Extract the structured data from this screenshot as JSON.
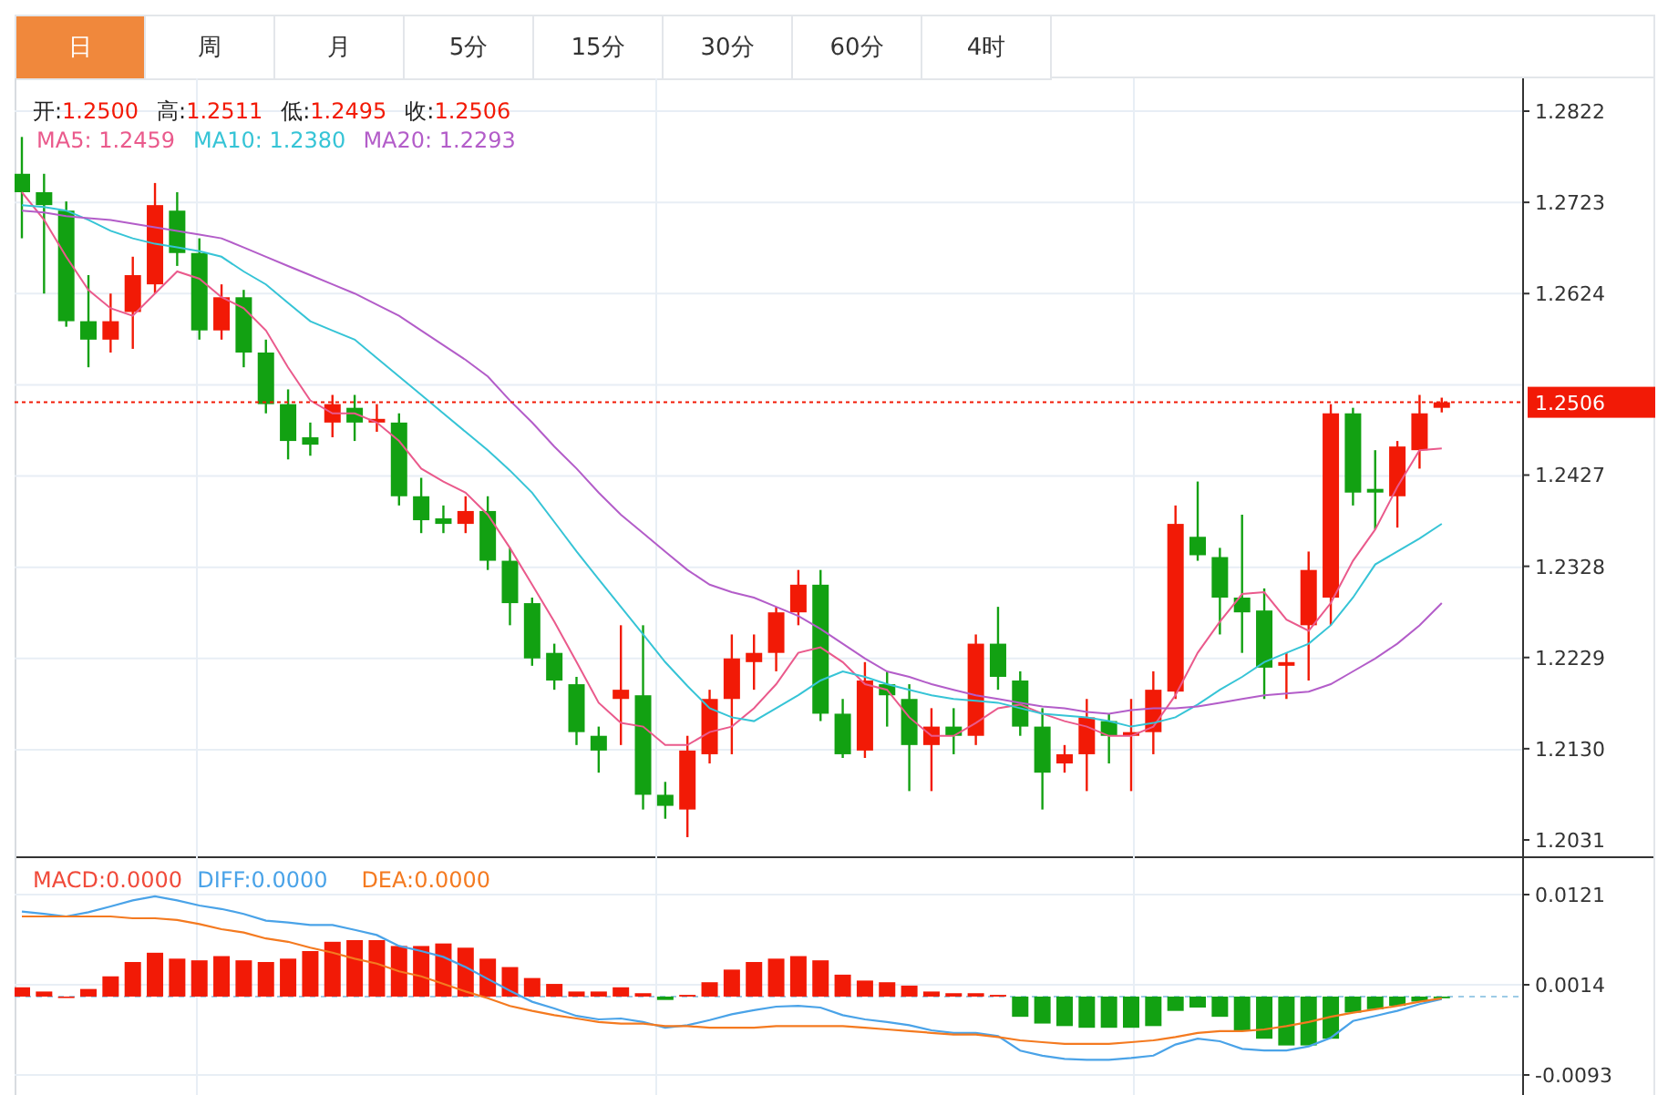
{
  "tabs": [
    {
      "label": "日",
      "selected": true
    },
    {
      "label": "周",
      "selected": false
    },
    {
      "label": "月",
      "selected": false
    },
    {
      "label": "5分",
      "selected": false
    },
    {
      "label": "15分",
      "selected": false
    },
    {
      "label": "30分",
      "selected": false
    },
    {
      "label": "60分",
      "selected": false
    },
    {
      "label": "4时",
      "selected": false
    }
  ],
  "price_chart": {
    "ohlc_legend": [
      {
        "label": "开:",
        "value": "1.2500"
      },
      {
        "label": "高:",
        "value": "1.2511"
      },
      {
        "label": "低:",
        "value": "1.2495"
      },
      {
        "label": "收:",
        "value": "1.2506"
      }
    ],
    "ma_legend": [
      {
        "label": "MA5:",
        "value": "1.2459",
        "color": "#ea5a8c"
      },
      {
        "label": "MA10:",
        "value": "1.2380",
        "color": "#36c4d6"
      },
      {
        "label": "MA20:",
        "value": "1.2293",
        "color": "#b35dc9"
      }
    ],
    "chart_data": {
      "type": "candlestick",
      "ylim": [
        1.2031,
        1.2822
      ],
      "grid": true,
      "ref_lines": [
        {
          "axis": "y",
          "value": 1.2506,
          "label": "1.2506",
          "color": "#f21a06"
        }
      ],
      "yticks": [
        {
          "value": 1.2822,
          "label": "1.2822"
        },
        {
          "value": 1.2723,
          "label": "1.2723"
        },
        {
          "value": 1.2624,
          "label": "1.2624"
        },
        {
          "value": 1.2427,
          "label": "1.2427"
        },
        {
          "value": 1.2328,
          "label": "1.2328"
        },
        {
          "value": 1.2229,
          "label": "1.2229"
        },
        {
          "value": 1.213,
          "label": "1.2130"
        },
        {
          "value": 1.2031,
          "label": "1.2031"
        }
      ],
      "ohlc": [
        [
          1.2754,
          1.2794,
          1.2684,
          1.2734
        ],
        [
          1.2734,
          1.2754,
          1.2624,
          1.272
        ],
        [
          1.2714,
          1.2724,
          1.2588,
          1.2594
        ],
        [
          1.2594,
          1.2644,
          1.2544,
          1.2574
        ],
        [
          1.2574,
          1.2624,
          1.256,
          1.2594
        ],
        [
          1.2604,
          1.2664,
          1.2564,
          1.2644
        ],
        [
          1.2634,
          1.2744,
          1.2624,
          1.272
        ],
        [
          1.2714,
          1.2734,
          1.2654,
          1.2668
        ],
        [
          1.2668,
          1.2684,
          1.2574,
          1.2584
        ],
        [
          1.2584,
          1.2634,
          1.2574,
          1.262
        ],
        [
          1.262,
          1.2628,
          1.2544,
          1.256
        ],
        [
          1.256,
          1.2574,
          1.2494,
          1.2504
        ],
        [
          1.2504,
          1.252,
          1.2444,
          1.2464
        ],
        [
          1.2468,
          1.2484,
          1.2448,
          1.246
        ],
        [
          1.2484,
          1.2514,
          1.2468,
          1.2504
        ],
        [
          1.25,
          1.2514,
          1.2464,
          1.2484
        ],
        [
          1.2484,
          1.2504,
          1.2474,
          1.2488
        ],
        [
          1.2484,
          1.2494,
          1.2394,
          1.2404
        ],
        [
          1.2404,
          1.2424,
          1.2364,
          1.2378
        ],
        [
          1.238,
          1.2394,
          1.2364,
          1.2374
        ],
        [
          1.2374,
          1.2404,
          1.2364,
          1.2388
        ],
        [
          1.2388,
          1.2404,
          1.2324,
          1.2334
        ],
        [
          1.2334,
          1.2348,
          1.2264,
          1.2288
        ],
        [
          1.2288,
          1.2294,
          1.222,
          1.2228
        ],
        [
          1.2234,
          1.2244,
          1.2194,
          1.2204
        ],
        [
          1.22,
          1.2208,
          1.2134,
          1.2148
        ],
        [
          1.2144,
          1.2154,
          1.2104,
          1.2128
        ],
        [
          1.2184,
          1.2264,
          1.2134,
          1.2194
        ],
        [
          1.2188,
          1.2264,
          1.2064,
          1.208
        ],
        [
          1.208,
          1.2094,
          1.2054,
          1.2068
        ],
        [
          1.2064,
          1.2144,
          1.2034,
          1.2128
        ],
        [
          1.2124,
          1.2194,
          1.2114,
          1.2184
        ],
        [
          1.2184,
          1.2254,
          1.2124,
          1.2228
        ],
        [
          1.2224,
          1.2254,
          1.2194,
          1.2234
        ],
        [
          1.2234,
          1.2284,
          1.2214,
          1.2278
        ],
        [
          1.2278,
          1.2324,
          1.2264,
          1.2308
        ],
        [
          1.2308,
          1.2324,
          1.216,
          1.2168
        ],
        [
          1.2168,
          1.2184,
          1.212,
          1.2124
        ],
        [
          1.2128,
          1.2224,
          1.212,
          1.2204
        ],
        [
          1.22,
          1.2214,
          1.2154,
          1.2188
        ],
        [
          1.2184,
          1.22,
          1.2084,
          1.2134
        ],
        [
          1.2134,
          1.2174,
          1.2084,
          1.2154
        ],
        [
          1.2154,
          1.2174,
          1.2124,
          1.2144
        ],
        [
          1.2144,
          1.2254,
          1.2134,
          1.2244
        ],
        [
          1.2244,
          1.2284,
          1.2194,
          1.2208
        ],
        [
          1.2204,
          1.2214,
          1.2144,
          1.2154
        ],
        [
          1.2154,
          1.2174,
          1.2064,
          1.2104
        ],
        [
          1.2114,
          1.2134,
          1.2104,
          1.2124
        ],
        [
          1.2124,
          1.2184,
          1.2084,
          1.2164
        ],
        [
          1.216,
          1.2168,
          1.2114,
          1.2144
        ],
        [
          1.2144,
          1.2184,
          1.2084,
          1.2148
        ],
        [
          1.2148,
          1.2214,
          1.2124,
          1.2194
        ],
        [
          1.2192,
          1.2394,
          1.2184,
          1.2374
        ],
        [
          1.236,
          1.242,
          1.2334,
          1.234
        ],
        [
          1.2338,
          1.2348,
          1.2254,
          1.2294
        ],
        [
          1.2294,
          1.2384,
          1.2234,
          1.2278
        ],
        [
          1.228,
          1.2304,
          1.2184,
          1.2218
        ],
        [
          1.222,
          1.2234,
          1.2184,
          1.2224
        ],
        [
          1.2264,
          1.2344,
          1.2204,
          1.2324
        ],
        [
          1.2294,
          1.2504,
          1.2264,
          1.2494
        ],
        [
          1.2494,
          1.25,
          1.2394,
          1.2408
        ],
        [
          1.2412,
          1.2454,
          1.2368,
          1.2408
        ],
        [
          1.2404,
          1.2464,
          1.237,
          1.2458
        ],
        [
          1.2454,
          1.2514,
          1.2434,
          1.2494
        ],
        [
          1.25,
          1.2511,
          1.2495,
          1.2506
        ]
      ],
      "series": [
        {
          "type": "line",
          "color": "#ea5a8c",
          "values": [
            1.2734,
            1.2704,
            1.2664,
            1.2628,
            1.2608,
            1.26,
            1.2624,
            1.2648,
            1.264,
            1.262,
            1.2608,
            1.2584,
            1.2544,
            1.2508,
            1.2494,
            1.2494,
            1.2484,
            1.2464,
            1.2434,
            1.242,
            1.2408,
            1.2384,
            1.2348,
            1.2308,
            1.2268,
            1.2224,
            1.218,
            1.2158,
            1.2154,
            1.2134,
            1.2134,
            1.2148,
            1.2154,
            1.2174,
            1.22,
            1.2234,
            1.224,
            1.2224,
            1.22,
            1.2194,
            1.2164,
            1.2144,
            1.2144,
            1.2158,
            1.2174,
            1.2178,
            1.2168,
            1.216,
            1.2154,
            1.2144,
            1.2144,
            1.2154,
            1.2188,
            1.2234,
            1.2268,
            1.2298,
            1.23,
            1.227,
            1.2258,
            1.2288,
            1.2334,
            1.2368,
            1.2414,
            1.2454,
            1.2456
          ]
        },
        {
          "type": "line",
          "color": "#36c4d6",
          "values": [
            1.272,
            1.2718,
            1.2714,
            1.2704,
            1.2692,
            1.2684,
            1.2678,
            1.2674,
            1.267,
            1.2664,
            1.2648,
            1.2634,
            1.2614,
            1.2594,
            1.2584,
            1.2574,
            1.2554,
            1.2534,
            1.2514,
            1.2494,
            1.2474,
            1.2454,
            1.2432,
            1.2408,
            1.2376,
            1.2344,
            1.2314,
            1.2284,
            1.2254,
            1.2224,
            1.2198,
            1.2174,
            1.2164,
            1.216,
            1.2174,
            1.2188,
            1.2204,
            1.2214,
            1.2208,
            1.22,
            1.2194,
            1.2188,
            1.2184,
            1.2182,
            1.218,
            1.2174,
            1.2168,
            1.2166,
            1.2164,
            1.216,
            1.2154,
            1.2158,
            1.2164,
            1.2178,
            1.2194,
            1.2208,
            1.2224,
            1.2234,
            1.2244,
            1.2264,
            1.2294,
            1.233,
            1.2344,
            1.2358,
            1.2374
          ]
        },
        {
          "type": "line",
          "color": "#b35dc9",
          "values": [
            1.2714,
            1.2712,
            1.2708,
            1.2706,
            1.2704,
            1.27,
            1.2696,
            1.2692,
            1.2688,
            1.2684,
            1.2674,
            1.2664,
            1.2654,
            1.2644,
            1.2634,
            1.2624,
            1.2612,
            1.26,
            1.2584,
            1.2568,
            1.2552,
            1.2534,
            1.2508,
            1.2484,
            1.2458,
            1.2434,
            1.2408,
            1.2384,
            1.2364,
            1.2344,
            1.2324,
            1.2308,
            1.23,
            1.2294,
            1.2284,
            1.2274,
            1.226,
            1.2244,
            1.2228,
            1.2214,
            1.2208,
            1.22,
            1.2194,
            1.2188,
            1.2184,
            1.218,
            1.2176,
            1.2174,
            1.217,
            1.2168,
            1.2172,
            1.2174,
            1.2174,
            1.2176,
            1.218,
            1.2184,
            1.2188,
            1.219,
            1.2192,
            1.22,
            1.2214,
            1.2228,
            1.2244,
            1.2264,
            1.2288
          ]
        }
      ]
    }
  },
  "macd_chart": {
    "legend": [
      {
        "label": "MACD:",
        "value": "0.0000",
        "color": "#f04a3a"
      },
      {
        "label": "DIFF:",
        "value": "0.0000",
        "color": "#4aa3e8"
      },
      {
        "label": "DEA:",
        "value": "0.0000",
        "color": "#f47a20"
      }
    ],
    "chart_data": {
      "type": "bar",
      "ylim": [
        -0.0093,
        0.0121
      ],
      "grid": true,
      "yticks": [
        {
          "value": 0.0121,
          "label": "0.0121"
        },
        {
          "value": 0.0014,
          "label": "0.0014"
        },
        {
          "value": -0.0093,
          "label": "-0.0093"
        }
      ],
      "ref_lines": [
        {
          "axis": "y",
          "value": 0,
          "color": "#9ccbe6"
        }
      ],
      "series": [
        {
          "colors": [
            "#f21a06",
            "#f21a06",
            "#f21a06",
            "#f21a06",
            "#f21a06",
            "#f21a06",
            "#f21a06",
            "#f21a06",
            "#f21a06",
            "#f21a06",
            "#f21a06",
            "#f21a06",
            "#f21a06",
            "#f21a06",
            "#f21a06",
            "#f21a06",
            "#f21a06",
            "#f21a06",
            "#f21a06",
            "#f21a06",
            "#f21a06",
            "#f21a06",
            "#f21a06",
            "#f21a06",
            "#f21a06",
            "#f21a06",
            "#f21a06",
            "#f21a06",
            "#f21a06",
            "#12a112",
            "#f21a06",
            "#f21a06",
            "#f21a06",
            "#f21a06",
            "#f21a06",
            "#f21a06",
            "#f21a06",
            "#f21a06",
            "#f21a06",
            "#f21a06",
            "#f21a06",
            "#f21a06",
            "#f21a06",
            "#f21a06",
            "#f21a06",
            "#12a112",
            "#12a112",
            "#12a112",
            "#12a112",
            "#12a112",
            "#12a112",
            "#12a112",
            "#12a112",
            "#12a112",
            "#12a112",
            "#12a112",
            "#12a112",
            "#12a112",
            "#12a112",
            "#12a112",
            "#12a112",
            "#12a112",
            "#12a112",
            "#12a112",
            "#12a112"
          ],
          "values": [
            0.0011,
            0.0006,
            0.0,
            0.0009,
            0.0024,
            0.0041,
            0.0052,
            0.0045,
            0.0043,
            0.0048,
            0.0043,
            0.0041,
            0.0045,
            0.0054,
            0.0065,
            0.0067,
            0.0067,
            0.006,
            0.006,
            0.0063,
            0.0058,
            0.0045,
            0.0035,
            0.0022,
            0.0015,
            0.0006,
            0.0006,
            0.0011,
            0.0004,
            -0.0004,
            0.0002,
            0.0017,
            0.0032,
            0.0041,
            0.0045,
            0.0048,
            0.0043,
            0.0026,
            0.0019,
            0.0017,
            0.0013,
            0.0006,
            0.0004,
            0.0004,
            0.0002,
            -0.0024,
            -0.0032,
            -0.0035,
            -0.0037,
            -0.0037,
            -0.0037,
            -0.0035,
            -0.0017,
            -0.0013,
            -0.0024,
            -0.0041,
            -0.005,
            -0.0058,
            -0.0058,
            -0.005,
            -0.0019,
            -0.0015,
            -0.0011,
            -0.0006,
            -0.0002
          ]
        },
        {
          "type": "line",
          "color": "#4aa3e8",
          "values": [
            0.0101,
            0.0098,
            0.0095,
            0.01,
            0.0107,
            0.0114,
            0.0119,
            0.0114,
            0.0108,
            0.0104,
            0.0098,
            0.009,
            0.0088,
            0.0085,
            0.0085,
            0.0079,
            0.0073,
            0.006,
            0.0054,
            0.0047,
            0.0035,
            0.0021,
            0.0007,
            -0.0006,
            -0.0014,
            -0.0023,
            -0.0027,
            -0.0026,
            -0.003,
            -0.0037,
            -0.0034,
            -0.0028,
            -0.0021,
            -0.0016,
            -0.0012,
            -0.0011,
            -0.0013,
            -0.0022,
            -0.0027,
            -0.003,
            -0.0034,
            -0.004,
            -0.0043,
            -0.0043,
            -0.0047,
            -0.0064,
            -0.007,
            -0.0074,
            -0.0075,
            -0.0075,
            -0.0073,
            -0.007,
            -0.0057,
            -0.005,
            -0.0053,
            -0.0062,
            -0.0064,
            -0.0064,
            -0.0059,
            -0.0049,
            -0.0029,
            -0.0023,
            -0.0017,
            -0.0009,
            -0.0003
          ]
        },
        {
          "type": "line",
          "color": "#f47a20",
          "values": [
            0.0095,
            0.0095,
            0.0095,
            0.0095,
            0.0095,
            0.0093,
            0.0093,
            0.0091,
            0.0086,
            0.008,
            0.0076,
            0.0069,
            0.0065,
            0.0058,
            0.0052,
            0.0045,
            0.0039,
            0.003,
            0.0024,
            0.0015,
            0.0006,
            -0.0002,
            -0.0011,
            -0.0017,
            -0.0022,
            -0.0026,
            -0.003,
            -0.0032,
            -0.0032,
            -0.0035,
            -0.0035,
            -0.0037,
            -0.0037,
            -0.0037,
            -0.0035,
            -0.0035,
            -0.0035,
            -0.0035,
            -0.0037,
            -0.0039,
            -0.0041,
            -0.0043,
            -0.0045,
            -0.0045,
            -0.0048,
            -0.0052,
            -0.0054,
            -0.0056,
            -0.0056,
            -0.0056,
            -0.0054,
            -0.0052,
            -0.0048,
            -0.0043,
            -0.0041,
            -0.0041,
            -0.0039,
            -0.0035,
            -0.003,
            -0.0024,
            -0.0019,
            -0.0015,
            -0.0011,
            -0.0006,
            -0.0002
          ]
        }
      ]
    }
  }
}
